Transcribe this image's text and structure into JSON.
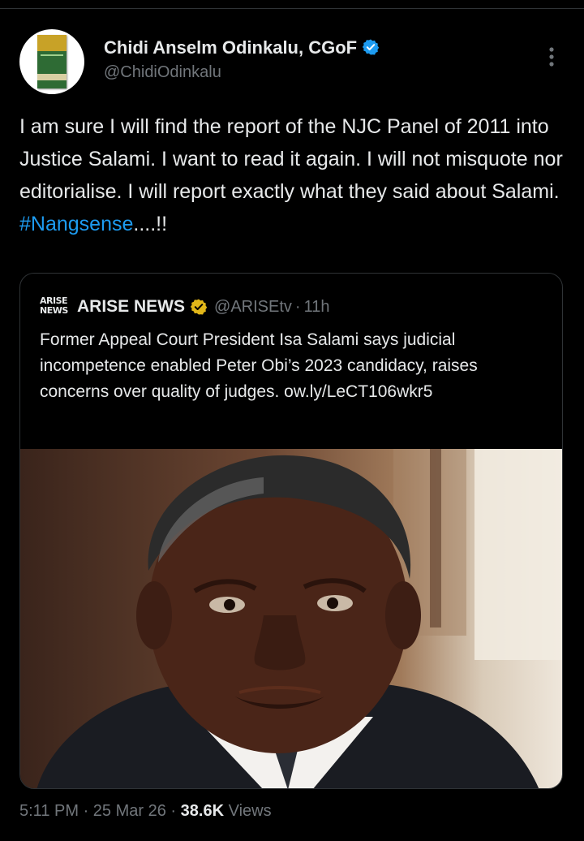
{
  "author": {
    "display_name": "Chidi Anselm Odinkalu, CGoF",
    "handle": "@ChidiOdinkalu",
    "avatar_text": [
      "THE",
      "SELECTORATE",
      "CHIDI ANSELM",
      "ODINKALU"
    ]
  },
  "tweet": {
    "text": "I am sure I will find the report of the NJC Panel of 2011 into Justice Salami. I want to read it again. I will not misquote nor editorialise. I will report exactly what they said about Salami. ",
    "hashtag": "#Nangsense",
    "text_suffix": "....!!"
  },
  "quote": {
    "logo_text": [
      "ARISE",
      "NEWS"
    ],
    "name": "ARISE NEWS",
    "handle": "@ARISEtv",
    "separator": "·",
    "time": "11h",
    "text": "Former Appeal Court President Isa Salami says judicial incompetence enabled Peter Obi’s 2023 candidacy, raises concerns over quality of judges. ow.ly/LeCT106wkr5",
    "image_alt": "Portrait of an elderly man"
  },
  "meta": {
    "time": "5:11 PM",
    "separator": "·",
    "date": "25 Mar 26",
    "views_count": "38.6K",
    "views_label": "Views"
  },
  "colors": {
    "background": "#000000",
    "text": "#e7e9ea",
    "secondary": "#71767b",
    "accent": "#1d9bf0",
    "divider": "#2f3336",
    "gold": "#e2b719"
  },
  "icons": {
    "verified": "verified-badge-icon",
    "quote_verified": "gold-verified-badge-icon",
    "more": "more-vertical-icon"
  }
}
